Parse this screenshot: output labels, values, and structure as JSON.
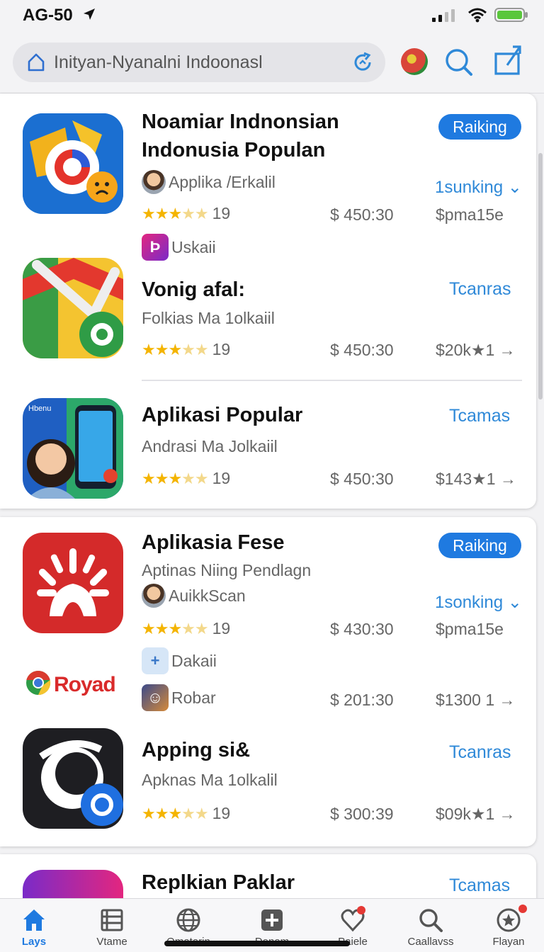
{
  "status": {
    "time": "AG-50"
  },
  "address": {
    "url": "Inityan-Nyanalni Indoonasl"
  },
  "apps": [
    {
      "title": "Noamiar Indnonsian Indonusia Populan",
      "developer": "Applika /Erkalil",
      "badge": "Raiking",
      "rank": "1sunking",
      "rating": "19",
      "price": "$ 450:30",
      "price_alt": "$pma15e",
      "extra_label": "Uskaii"
    },
    {
      "title": "Vonig afal:",
      "subtitle": "Folkias Ma 1olkaiil",
      "action": "Tcanras",
      "rating": "19",
      "price": "$ 450:30",
      "price_alt": "$20k★1 →"
    },
    {
      "title": "Aplikasi Popular",
      "subtitle": "Andrasi Ma Jolkaiil",
      "action": "Tcamas",
      "rating": "19",
      "price": "$ 450:30",
      "price_alt": "$143★1 →"
    },
    {
      "title": "Aplikasia Fese",
      "subtitle": "Aptinas Niing Pendlagn",
      "developer": "AuikkScan",
      "badge": "Raiking",
      "rank": "1sonking",
      "rating": "19",
      "price": "$ 430:30",
      "price_alt": "$pma15e",
      "extra_label": "Dakaii",
      "sub_app_label": "Robar",
      "sub_app_price": "$ 201:30",
      "sub_app_price_alt": "$1300 1 →"
    },
    {
      "title": "Apping si&",
      "subtitle": "Apknas Ma 1olkalil",
      "action": "Tcanras",
      "rating": "19",
      "price": "$ 300:39",
      "price_alt": "$09k★1 →"
    },
    {
      "title": "Replkian Paklar",
      "action": "Tcamas"
    }
  ],
  "royad": {
    "brand": "Royad"
  },
  "tabs": [
    {
      "label": "Lays",
      "icon": "home-icon",
      "active": true
    },
    {
      "label": "Vtame",
      "icon": "list-icon"
    },
    {
      "label": "Omatarin",
      "icon": "globe-icon"
    },
    {
      "label": "Donam",
      "icon": "plus-box-icon"
    },
    {
      "label": "Paiele",
      "icon": "heart-icon"
    },
    {
      "label": "Caallavss",
      "icon": "search-icon"
    },
    {
      "label": "Flayan",
      "icon": "star-circle-icon"
    }
  ],
  "colors": {
    "accent": "#1f7ae0",
    "link": "#2f89d8",
    "star": "#f4b400"
  }
}
